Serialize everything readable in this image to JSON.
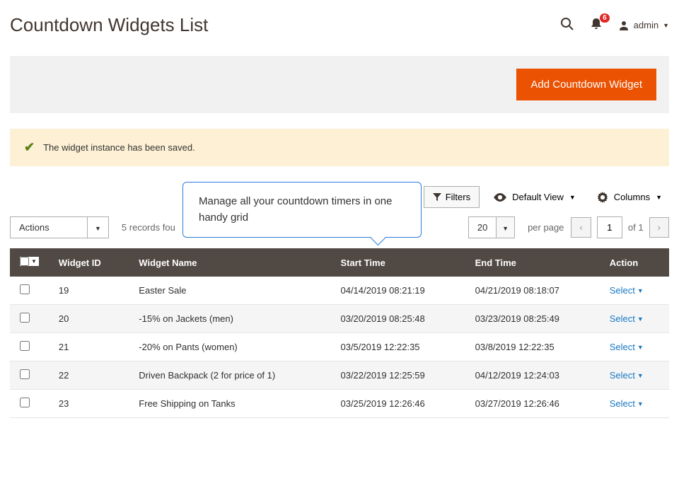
{
  "page_title": "Countdown Widgets List",
  "notification_count": "6",
  "user_name": "admin",
  "primary_action": "Add Countdown Widget",
  "success_message": "The widget instance has been saved.",
  "tooltip_text": "Manage all your countdown timers in one handy grid",
  "toolbar": {
    "filters": "Filters",
    "default_view": "Default View",
    "columns": "Columns"
  },
  "controls": {
    "actions": "Actions",
    "records_found": "5 records fou",
    "per_page_value": "20",
    "per_page_label": "per page",
    "page_current": "1",
    "page_of": "of 1"
  },
  "columns": {
    "widget_id": "Widget ID",
    "widget_name": "Widget Name",
    "start_time": "Start Time",
    "end_time": "End Time",
    "action": "Action"
  },
  "action_label": "Select",
  "rows": [
    {
      "id": "19",
      "name": "Easter Sale",
      "start": "04/14/2019 08:21:19",
      "end": "04/21/2019 08:18:07"
    },
    {
      "id": "20",
      "name": "-15% on Jackets (men)",
      "start": "03/20/2019 08:25:48",
      "end": "03/23/2019 08:25:49"
    },
    {
      "id": "21",
      "name": "-20% on Pants (women)",
      "start": "03/5/2019 12:22:35",
      "end": "03/8/2019 12:22:35"
    },
    {
      "id": "22",
      "name": "Driven Backpack (2 for price of 1)",
      "start": "03/22/2019 12:25:59",
      "end": "04/12/2019 12:24:03"
    },
    {
      "id": "23",
      "name": "Free Shipping on Tanks",
      "start": "03/25/2019 12:26:46",
      "end": "03/27/2019 12:26:46"
    }
  ]
}
